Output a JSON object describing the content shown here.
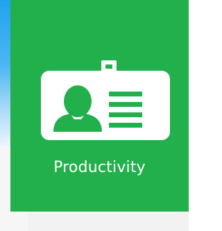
{
  "tile": {
    "label": "Productivity",
    "icon": "id-badge-icon",
    "color": "#21b04b"
  },
  "background": {
    "accent": "#21a3f0"
  }
}
